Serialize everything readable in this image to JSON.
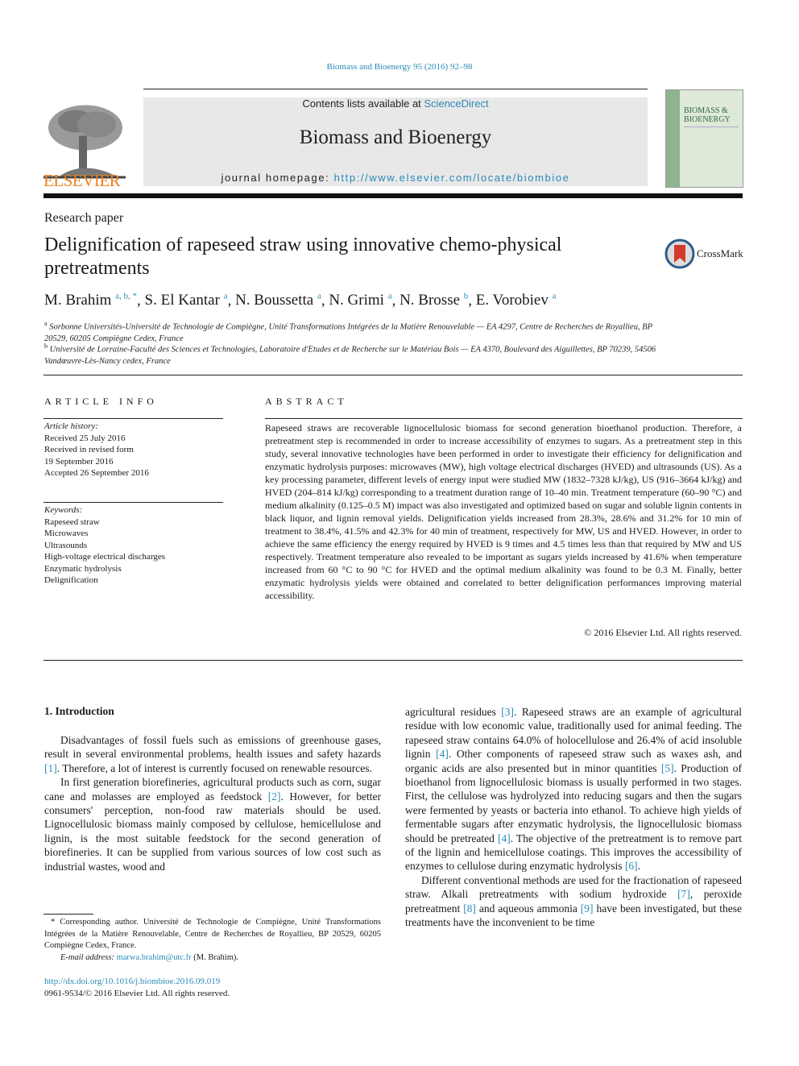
{
  "running_head": "Biomass and Bioenergy 95 (2016) 92–98",
  "masthead": {
    "contents_prefix": "Contents lists available at ",
    "contents_link": "ScienceDirect",
    "journal_title": "Biomass and Bioenergy",
    "homepage_prefix": "journal homepage: ",
    "homepage_link": "http://www.elsevier.com/locate/biombioe",
    "publisher": "ELSEVIER",
    "cover_title_line1": "BIOMASS &",
    "cover_title_line2": "BIOENERGY"
  },
  "article": {
    "type": "Research paper",
    "title": "Delignification of rapeseed straw using innovative chemo-physical pretreatments",
    "crossmark_label": "CrossMark",
    "authors": [
      {
        "name": "M. Brahim",
        "sup": "a, b, *"
      },
      {
        "name": "S. El Kantar",
        "sup": "a"
      },
      {
        "name": "N. Boussetta",
        "sup": "a"
      },
      {
        "name": "N. Grimi",
        "sup": "a"
      },
      {
        "name": "N. Brosse",
        "sup": "b"
      },
      {
        "name": "E. Vorobiev",
        "sup": "a"
      }
    ],
    "affiliations": [
      {
        "mark": "a",
        "text": "Sorbonne Universités-Université de Technologie de Compiègne, Unité Transformations Intégrées de la Matière Renouvelable — EA 4297, Centre de Recherches de Royallieu, BP 20529, 60205 Compiègne Cedex, France"
      },
      {
        "mark": "b",
        "text": "Université de Lorraine-Faculté des Sciences et Technologies, Laboratoire d'Etudes et de Recherche sur le Matériau Bois — EA 4370, Boulevard des Aiguillettes, BP 70239, 54506 Vandœuvre-Lès-Nancy cedex, France"
      }
    ]
  },
  "article_info": {
    "heading": "ARTICLE INFO",
    "history_label": "Article history:",
    "history": [
      "Received 25 July 2016",
      "Received in revised form",
      "19 September 2016",
      "Accepted 26 September 2016"
    ],
    "keywords_label": "Keywords:",
    "keywords": [
      "Rapeseed straw",
      "Microwaves",
      "Ultrasounds",
      "High-voltage electrical discharges",
      "Enzymatic hydrolysis",
      "Delignification"
    ]
  },
  "abstract": {
    "heading": "ABSTRACT",
    "text": "Rapeseed straws are recoverable lignocellulosic biomass for second generation bioethanol production. Therefore, a pretreatment step is recommended in order to increase accessibility of enzymes to sugars. As a pretreatment step in this study, several innovative technologies have been performed in order to investigate their efficiency for delignification and enzymatic hydrolysis purposes: microwaves (MW), high voltage electrical discharges (HVED) and ultrasounds (US). As a key processing parameter, different levels of energy input were studied MW (1832–7328 kJ/kg), US (916–3664 kJ/kg) and HVED (204–814 kJ/kg) corresponding to a treatment duration range of 10–40 min. Treatment temperature (60–90 °C) and medium alkalinity (0.125–0.5 M) impact was also investigated and optimized based on sugar and soluble lignin contents in black liquor, and lignin removal yields. Delignification yields increased from 28.3%, 28.6% and 31.2% for 10 min of treatment to 38.4%, 41.5% and 42.3% for 40 min of treatment, respectively for MW, US and HVED. However, in order to achieve the same efficiency the energy required by HVED is 9 times and 4.5 times less than that required by MW and US respectively. Treatment temperature also revealed to be important as sugars yields increased by 41.6% when temperature increased from 60 °C to 90 °C for HVED and the optimal medium alkalinity was found to be 0.3 M. Finally, better enzymatic hydrolysis yields were obtained and correlated to better delignification performances improving material accessibility.",
    "copyright": "© 2016 Elsevier Ltd. All rights reserved."
  },
  "introduction": {
    "heading": "1.  Introduction",
    "left_paragraphs": [
      [
        {
          "t": "Disadvantages of fossil fuels such as emissions of greenhouse gases, result in several environmental problems, health issues and safety hazards "
        },
        {
          "ref": "[1]"
        },
        {
          "t": ". Therefore, a lot of interest is currently focused on renewable resources."
        }
      ],
      [
        {
          "t": "In first generation biorefineries, agricultural products such as corn, sugar cane and molasses are employed as feedstock "
        },
        {
          "ref": "[2]"
        },
        {
          "t": ". However, for better consumers' perception, non-food raw materials should be used. Lignocellulosic biomass mainly composed by cellulose, hemicellulose and lignin, is the most suitable feedstock for the second generation of biorefineries. It can be supplied from various sources of low cost such as industrial wastes, wood and"
        }
      ]
    ],
    "right_paragraphs": [
      [
        {
          "t": "agricultural residues "
        },
        {
          "ref": "[3]"
        },
        {
          "t": ". Rapeseed straws are an example of agricultural residue with low economic value, traditionally used for animal feeding. The rapeseed straw contains 64.0% of holocellulose and 26.4% of acid insoluble lignin "
        },
        {
          "ref": "[4]"
        },
        {
          "t": ". Other components of rapeseed straw such as waxes ash, and organic acids are also presented but in minor quantities "
        },
        {
          "ref": "[5]"
        },
        {
          "t": ". Production of bioethanol from lignocellulosic biomass is usually performed in two stages. First, the cellulose was hydrolyzed into reducing sugars and then the sugars were fermented by yeasts or bacteria into ethanol. To achieve high yields of fermentable sugars after enzymatic hydrolysis, the lignocellulosic biomass should be pretreated "
        },
        {
          "ref": "[4]"
        },
        {
          "t": ". The objective of the pretreatment is to remove part of the lignin and hemicellulose coatings. This improves the accessibility of enzymes to cellulose during enzymatic hydrolysis "
        },
        {
          "ref": "[6]"
        },
        {
          "t": "."
        }
      ],
      [
        {
          "t": "Different conventional methods are used for the fractionation of rapeseed straw. Alkali pretreatments with sodium hydroxide "
        },
        {
          "ref": "[7]"
        },
        {
          "t": ", peroxide pretreatment "
        },
        {
          "ref": "[8]"
        },
        {
          "t": " and aqueous ammonia "
        },
        {
          "ref": "[9]"
        },
        {
          "t": " have been investigated, but these treatments have the inconvenient to be time"
        }
      ]
    ]
  },
  "footnote": {
    "corresponding": "* Corresponding author. Université de Technologie de Compiègne, Unité Transformations Intégrées de la Matière Renouvelable, Centre de Recherches de Royallieu, BP 20529, 60205 Compiègne Cedex, France.",
    "email_label": "E-mail address: ",
    "email": "marwa.brahim@utc.fr",
    "email_suffix": " (M. Brahim).",
    "doi": "http://dx.doi.org/10.1016/j.biombioe.2016.09.019",
    "issn": "0961-9534/© 2016 Elsevier Ltd. All rights reserved."
  },
  "colors": {
    "link": "#2a8ab8",
    "elsevier_orange": "#f07f1b",
    "masthead_bg": "#e8e8e8"
  }
}
